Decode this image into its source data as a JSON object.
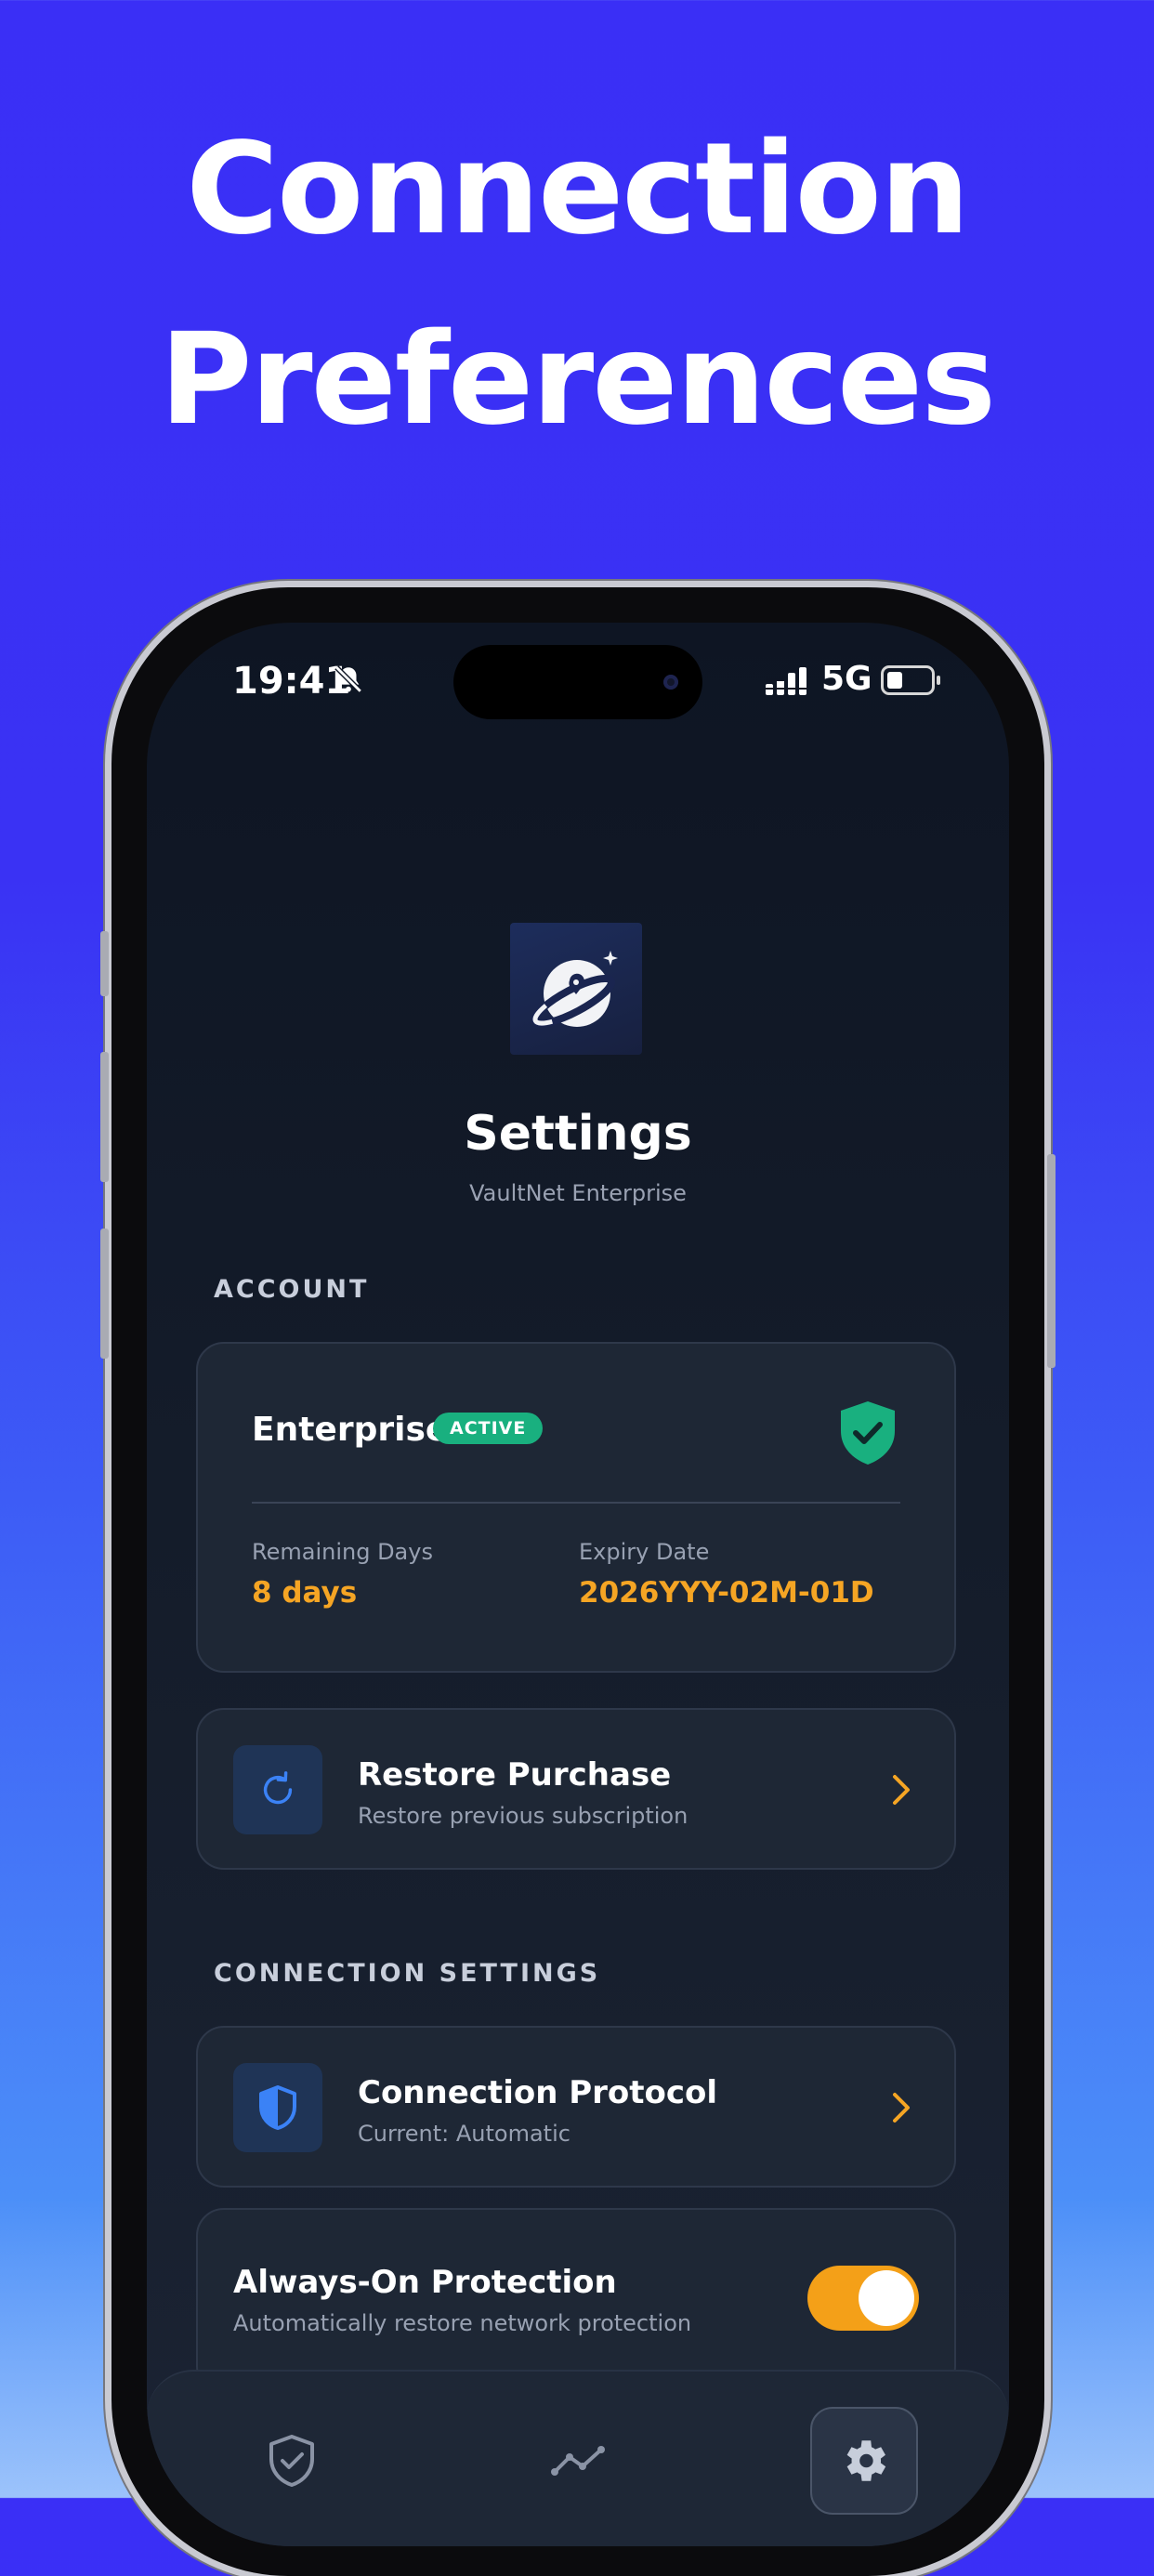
{
  "headline": {
    "line1": "Connection",
    "line2": "Preferences"
  },
  "status_bar": {
    "time": "19:41",
    "network": "5G"
  },
  "header": {
    "title": "Settings",
    "subtitle": "VaultNet Enterprise"
  },
  "account": {
    "section_label": "ACCOUNT",
    "plan": "Enterprise",
    "status_badge": "ACTIVE",
    "remaining_label": "Remaining Days",
    "remaining_value": "8 days",
    "expiry_label": "Expiry Date",
    "expiry_value": "2026YYY-02M-01D"
  },
  "restore": {
    "title": "Restore Purchase",
    "subtitle": "Restore previous subscription"
  },
  "connection": {
    "section_label": "CONNECTION SETTINGS",
    "protocol_title": "Connection Protocol",
    "protocol_sub": "Current: Automatic",
    "always_on_title": "Always-On Protection",
    "always_on_sub": "Automatically restore network protection",
    "always_on_enabled": true
  },
  "tabs": [
    {
      "icon": "shield-check-icon"
    },
    {
      "icon": "stats-line-icon"
    },
    {
      "icon": "gear-icon",
      "active": true
    }
  ],
  "colors": {
    "accent": "#f5a524",
    "success": "#19b07f",
    "background": "#3a2ff6"
  }
}
